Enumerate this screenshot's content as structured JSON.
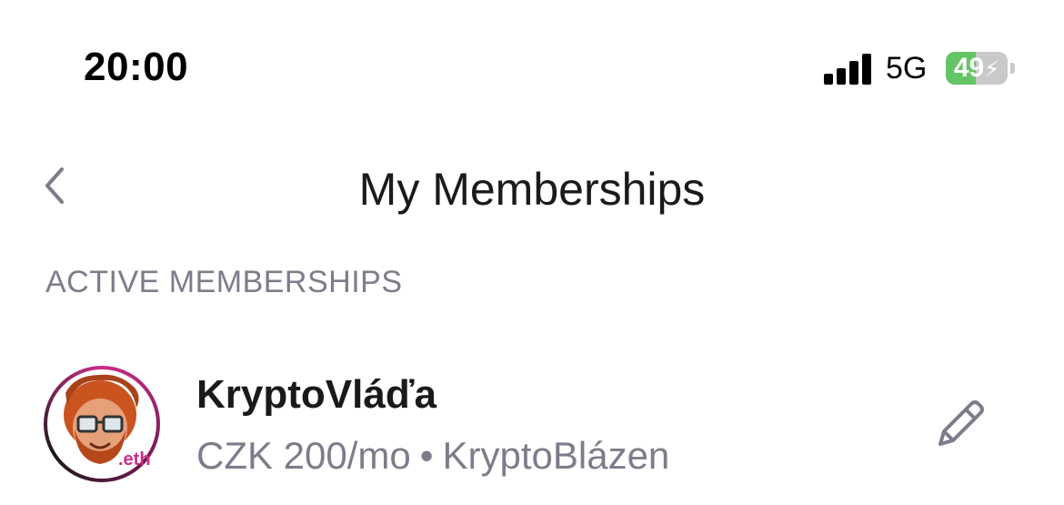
{
  "status_bar": {
    "time": "20:00",
    "network": "5G",
    "battery_level": 49,
    "battery_label": "49",
    "icons": [
      "signal-icon",
      "battery-icon",
      "charging-bolt-icon"
    ]
  },
  "nav": {
    "title": "My Memberships",
    "back_icon": "chevron-left-icon"
  },
  "section": {
    "header": "ACTIVE MEMBERSHIPS"
  },
  "memberships": [
    {
      "name": "KryptoVláďa",
      "price": "CZK 200/mo",
      "separator": "•",
      "tier": "KryptoBlázen",
      "avatar_badge": ".eth",
      "action_icon": "pencil-icon"
    }
  ],
  "colors": {
    "text_primary": "#1a1a1a",
    "text_secondary": "#7c7d8a",
    "battery_green": "#64c466",
    "avatar_ring": "#cc2e8a"
  }
}
